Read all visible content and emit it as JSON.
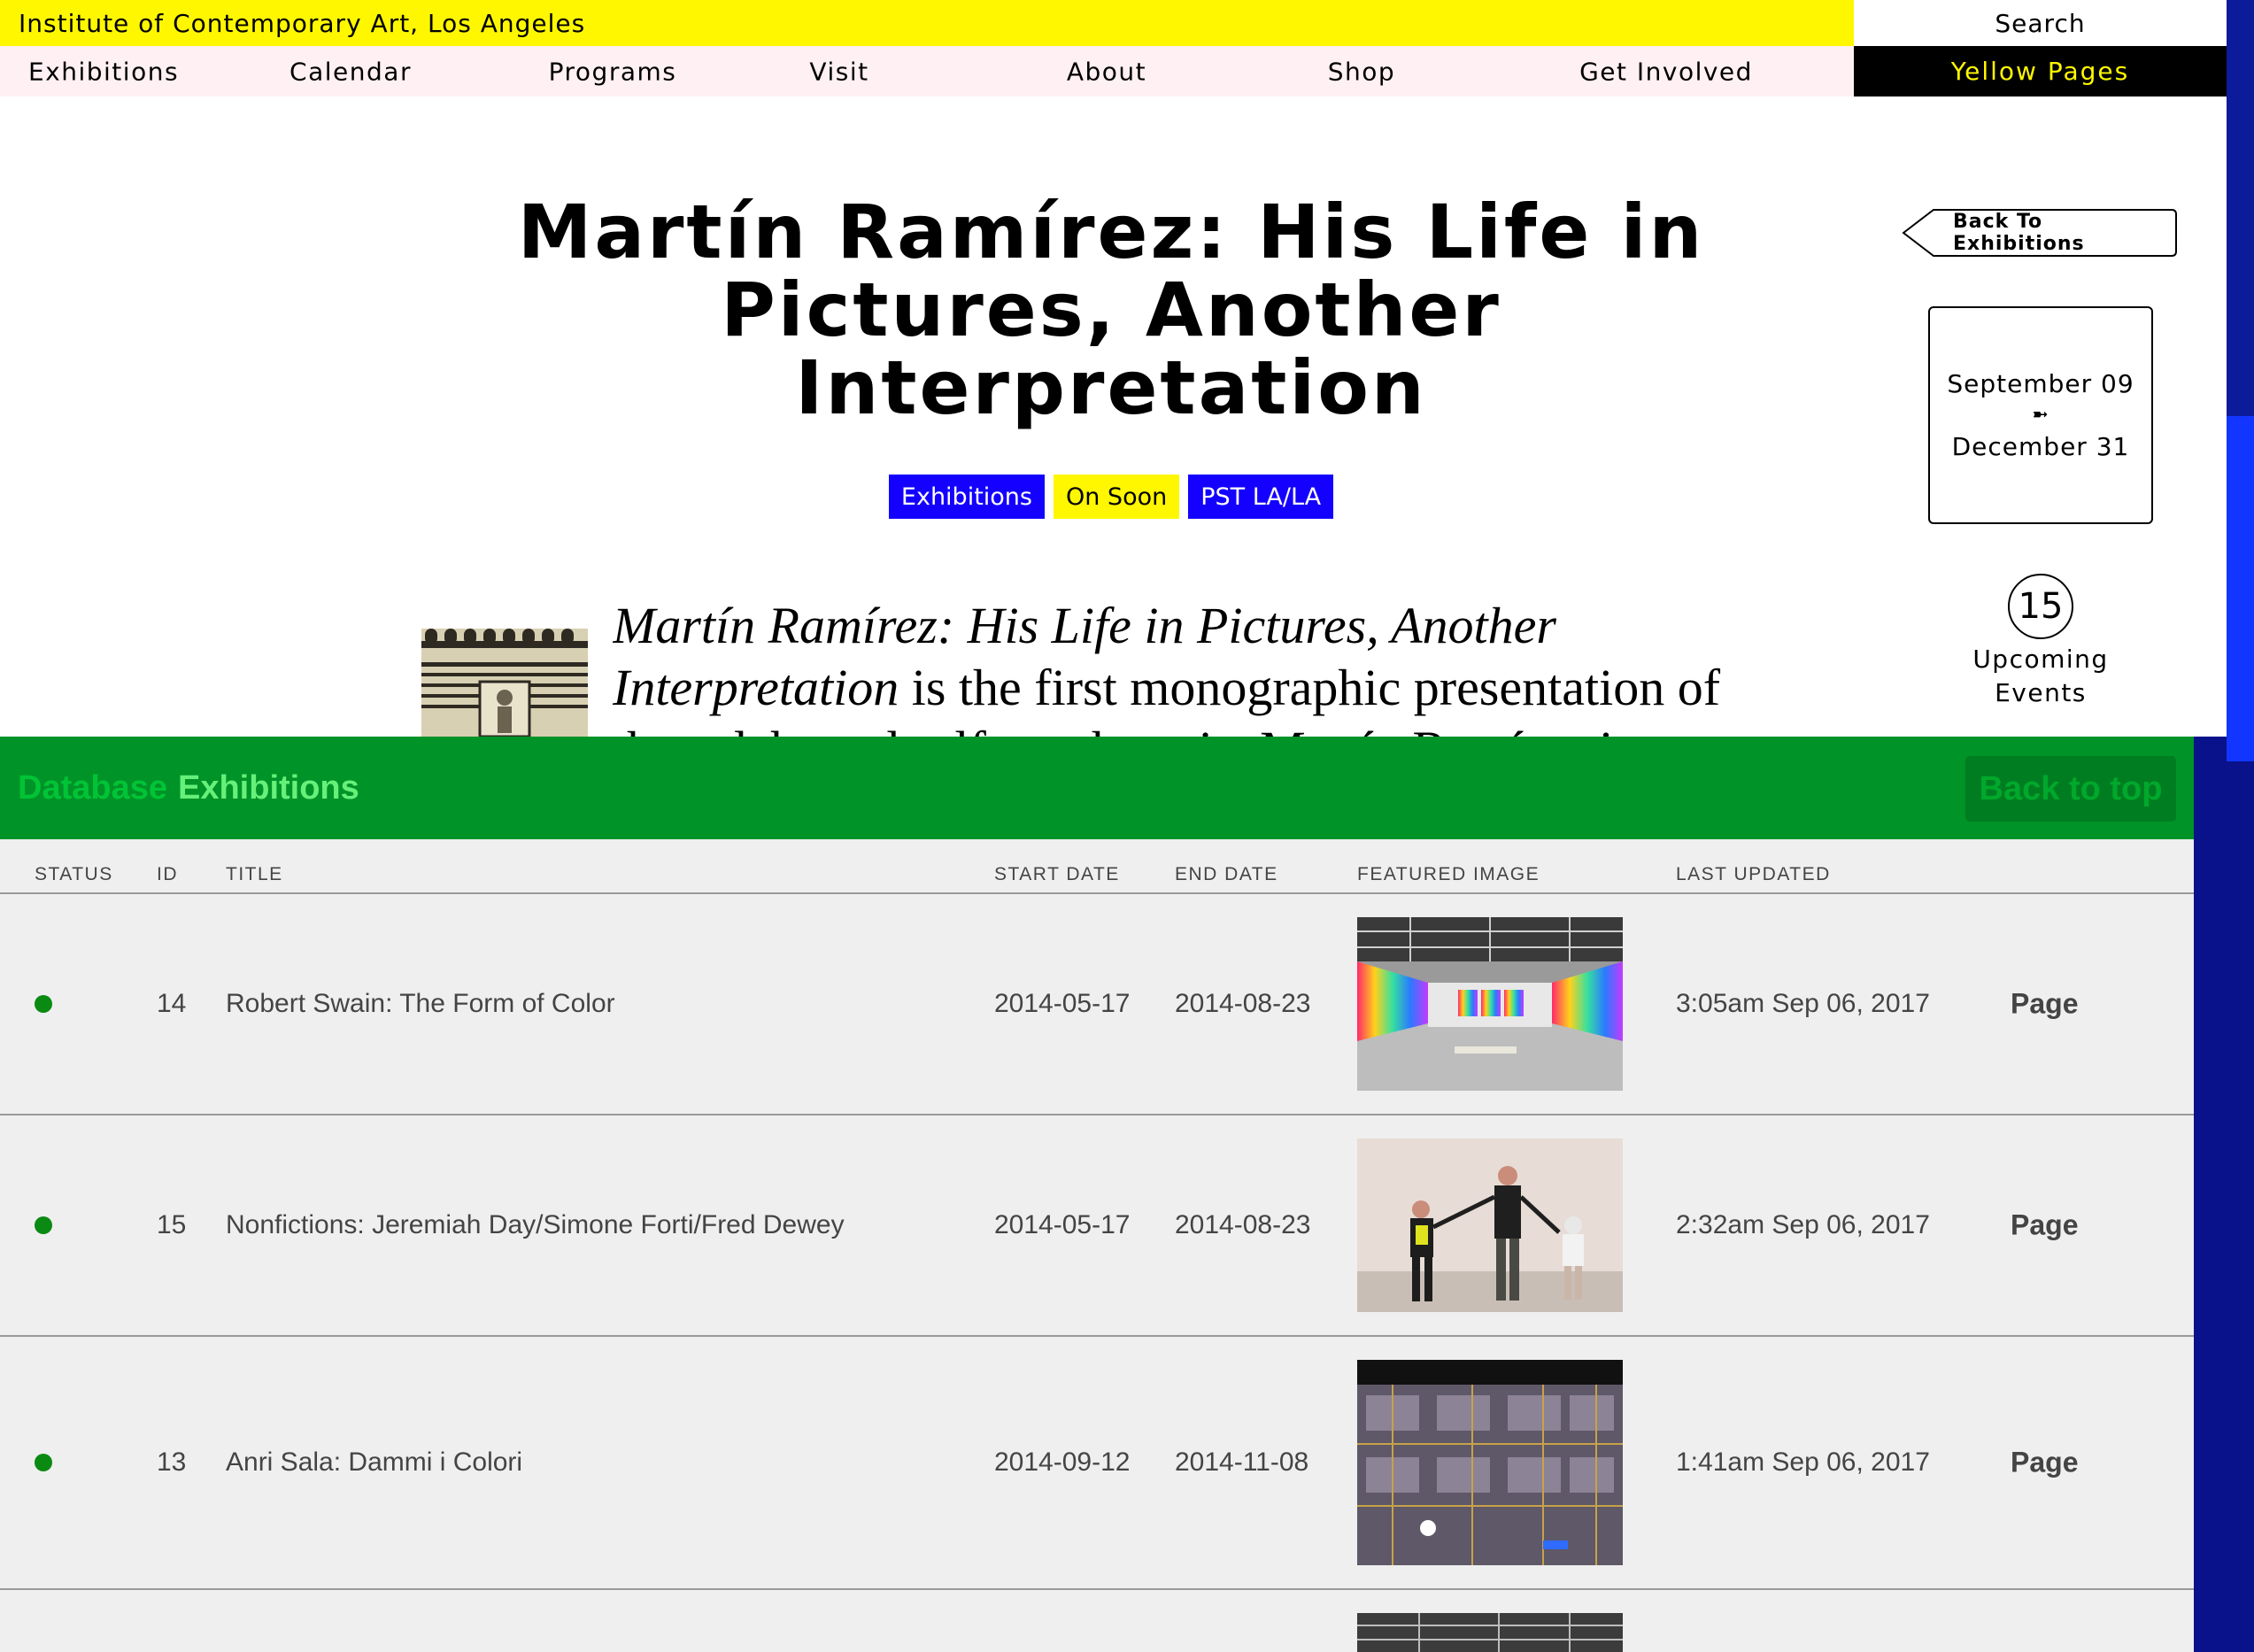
{
  "header": {
    "site_name": "Institute of Contemporary Art, Los Angeles",
    "search_label": "Search",
    "nav": [
      "Exhibitions",
      "Calendar",
      "Programs",
      "Visit",
      "About",
      "Shop",
      "Get Involved"
    ],
    "yellow_pages_label": "Yellow Pages"
  },
  "exhibition": {
    "title_lines": [
      "Martín Ramírez: His Life in",
      "Pictures, Another",
      "Interpretation"
    ],
    "tags": [
      "Exhibitions",
      "On Soon",
      "PST LA/LA"
    ],
    "back_label": "Back To Exhibitions",
    "start_date": "September 09",
    "date_arrow": "➼",
    "end_date": "December 31",
    "upcoming_count": "15",
    "upcoming_label_1": "Upcoming",
    "upcoming_label_2": "Events",
    "intro_italic_1": "Martín Ramírez: His Life in Pictures, Another",
    "intro_italic_2": "Interpretation",
    "intro_rest": " is the first monographic presentation of",
    "intro_cut": "the celebrated self-taught artist Martín Ramírez in"
  },
  "database": {
    "label_a": "Database",
    "label_b": "Exhibitions",
    "back_to_top": "Back to top",
    "columns": [
      "STATUS",
      "ID",
      "TITLE",
      "START DATE",
      "END DATE",
      "FEATURED IMAGE",
      "LAST UPDATED"
    ],
    "rows": [
      {
        "status": "published",
        "id": "14",
        "title": "Robert Swain: The Form of Color",
        "start": "2014-05-17",
        "end": "2014-08-23",
        "updated": "3:05am Sep 06, 2017",
        "link": "Page"
      },
      {
        "status": "published",
        "id": "15",
        "title": "Nonfictions: Jeremiah Day/Simone Forti/Fred Dewey",
        "start": "2014-05-17",
        "end": "2014-08-23",
        "updated": "2:32am Sep 06, 2017",
        "link": "Page"
      },
      {
        "status": "published",
        "id": "13",
        "title": "Anri Sala: Dammi i Colori",
        "start": "2014-09-12",
        "end": "2014-11-08",
        "updated": "1:41am Sep 06, 2017",
        "link": "Page"
      }
    ]
  },
  "colors": {
    "top_yellow": "#fff700",
    "nav_pink": "#fff0f3",
    "tag_blue": "#1300ff",
    "db_green": "#009327",
    "status_green": "#0a8a12",
    "scroll_blue": "#1236ff"
  }
}
